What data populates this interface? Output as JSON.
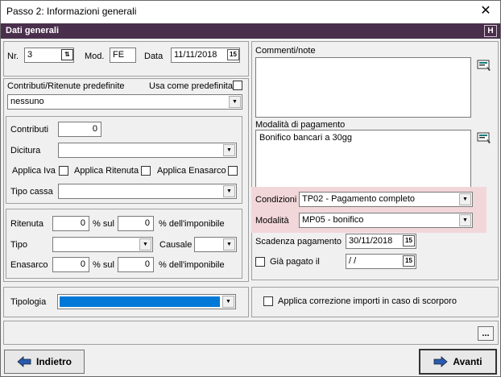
{
  "window": {
    "title": "Passo 2: Informazioni generali"
  },
  "header": {
    "title": "Dati generali",
    "help_label": "H"
  },
  "doc": {
    "nr_label": "Nr.",
    "nr_value": "3",
    "mod_label": "Mod.",
    "mod_value": "FE",
    "data_label": "Data",
    "data_value": "11/11/2018"
  },
  "contrib": {
    "section_label": "Contributi/Ritenute predefinite",
    "default_label": "Usa come predefinita",
    "preset_value": "nessuno",
    "contributi_label": "Contributi",
    "contributi_value": "0",
    "dicitura_label": "Dicitura",
    "dicitura_value": "",
    "applica_iva_label": "Applica Iva",
    "applica_ritenuta_label": "Applica Ritenuta",
    "applica_enasarco_label": "Applica Enasarco",
    "tipo_cassa_label": "Tipo cassa",
    "tipo_cassa_value": ""
  },
  "ritenuta": {
    "ritenuta_label": "Ritenuta",
    "ritenuta_pct": "0",
    "sul_label": "% sul",
    "ritenuta_base": "0",
    "imponibile_label": "% dell'imponibile",
    "tipo_label": "Tipo",
    "tipo_value": "",
    "causale_label": "Causale",
    "causale_value": "",
    "enasarco_label": "Enasarco",
    "enasarco_pct": "0",
    "enasarco_base": "0"
  },
  "tipologia": {
    "label": "Tipologia",
    "value": ""
  },
  "right": {
    "commenti_label": "Commenti/note",
    "commenti_value": "",
    "pagamento_label": "Modalità di pagamento",
    "pagamento_value": "Bonifico bancari a 30gg",
    "condizioni_label": "Condizioni",
    "condizioni_value": "TP02 - Pagamento completo",
    "modalita_label": "Modalità",
    "modalita_value": "MP05 - bonifico",
    "scadenza_label": "Scadenza pagamento",
    "scadenza_value": "30/11/2018",
    "gia_pagato_label": "Già pagato il",
    "gia_pagato_value": " /  /",
    "scorporo_label": "Applica correzione importi in caso di scorporo"
  },
  "footer": {
    "more_label": "...",
    "back_label": "Indietro",
    "next_label": "Avanti"
  },
  "colors": {
    "header_bg": "#4a2f4d",
    "highlight": "#f2d7da",
    "selection": "#0078d7"
  }
}
